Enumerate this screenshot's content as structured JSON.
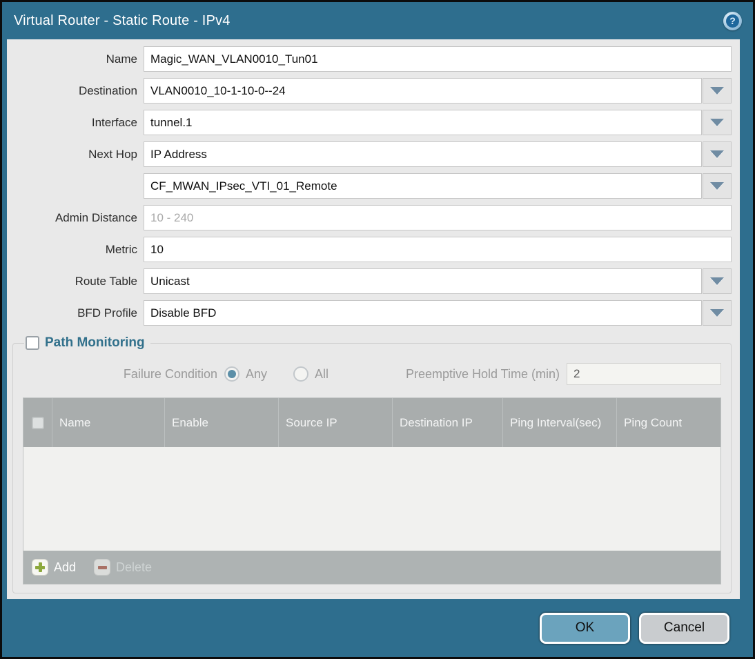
{
  "window": {
    "title": "Virtual Router - Static Route - IPv4"
  },
  "form": {
    "fields": [
      {
        "label": "Name",
        "value": "Magic_WAN_VLAN0010_Tun01"
      },
      {
        "label": "Destination",
        "value": "VLAN0010_10-1-10-0--24"
      },
      {
        "label": "Interface",
        "value": "tunnel.1"
      },
      {
        "label": "Next Hop",
        "value": "IP Address"
      },
      {
        "label": "",
        "value": "CF_MWAN_IPsec_VTI_01_Remote"
      },
      {
        "label": "Admin Distance",
        "value": "",
        "placeholder": "10 - 240"
      },
      {
        "label": "Metric",
        "value": "10"
      },
      {
        "label": "Route Table",
        "value": "Unicast"
      },
      {
        "label": "BFD Profile",
        "value": "Disable BFD"
      }
    ]
  },
  "path_monitoring": {
    "title": "Path Monitoring",
    "checkbox_checked": false,
    "failure_condition": {
      "label": "Failure Condition",
      "options": [
        "Any",
        "All"
      ],
      "selected": "Any"
    },
    "preemptive_hold_time": {
      "label": "Preemptive Hold Time (min)",
      "value": "2"
    },
    "table": {
      "columns": [
        "Name",
        "Enable",
        "Source IP",
        "Destination IP",
        "Ping Interval(sec)",
        "Ping Count"
      ],
      "rows": []
    },
    "toolbar": {
      "add_label": "Add",
      "delete_label": "Delete"
    }
  },
  "footer": {
    "ok_label": "OK",
    "cancel_label": "Cancel"
  },
  "colors": {
    "titlebar_teal": "#2e6e8e",
    "content_bg": "#e9e9e9",
    "table_header_bg": "#a9adad",
    "table_body_bg": "#f1f1ef",
    "toolbar_bg": "#aeb3b3",
    "ok_button": "#6ba3bd",
    "cancel_button": "#c9cccf",
    "legend_teal": "#31708b",
    "radio_selected_dot": "#5c8fa8",
    "add_icon_green": "#8ca83c",
    "delete_icon_red": "#a85c4c",
    "dropdown_arrow": "#708ca3"
  }
}
